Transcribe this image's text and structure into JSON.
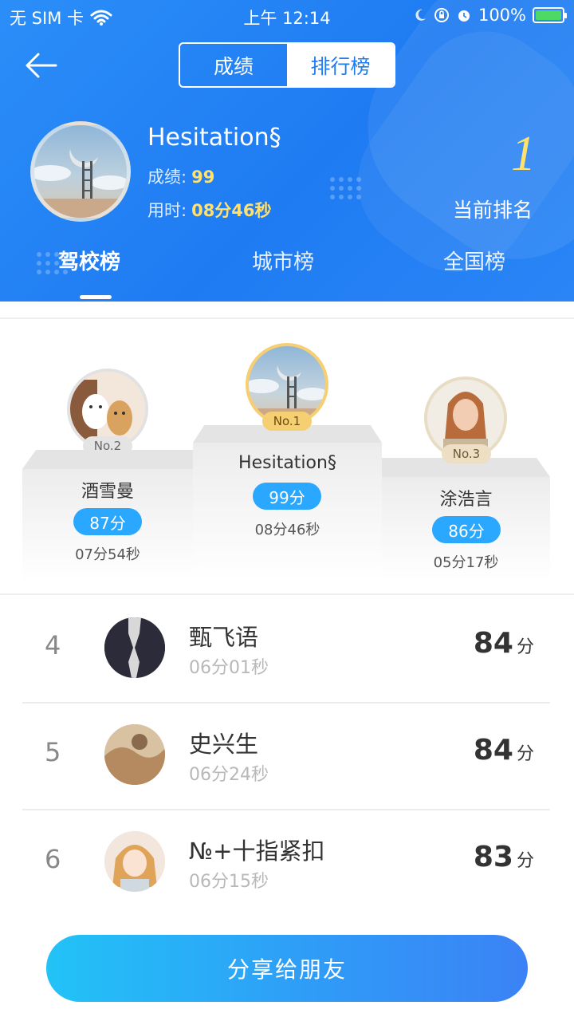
{
  "status_bar": {
    "carrier": "无 SIM 卡",
    "time": "上午 12:14",
    "battery": "100%"
  },
  "nav": {
    "segments": [
      "成绩",
      "排行榜"
    ],
    "active_segment": "排行榜"
  },
  "profile": {
    "name": "Hesitation§",
    "score_label": "成绩:",
    "score_value": "99",
    "time_label": "用时:",
    "time_value": "08分46秒",
    "rank_value": "1",
    "rank_label": "当前排名"
  },
  "tabs": [
    "驾校榜",
    "城市榜",
    "全国榜"
  ],
  "podium": {
    "first": {
      "badge": "No.1",
      "name": "Hesitation§",
      "score": "99分",
      "time": "08分46秒"
    },
    "second": {
      "badge": "No.2",
      "name": "酒雪曼",
      "score": "87分",
      "time": "07分54秒"
    },
    "third": {
      "badge": "No.3",
      "name": "涂浩言",
      "score": "86分",
      "time": "05分17秒"
    }
  },
  "list": [
    {
      "rank": "4",
      "name": "甄飞语",
      "time": "06分01秒",
      "score": "84",
      "unit": "分"
    },
    {
      "rank": "5",
      "name": "史兴生",
      "time": "06分24秒",
      "score": "84",
      "unit": "分"
    },
    {
      "rank": "6",
      "name": "№+十指紧扣",
      "time": "06分15秒",
      "score": "83",
      "unit": "分"
    }
  ],
  "share_button": "分享给朋友",
  "colors": {
    "header_blue": "#1f7bf2",
    "highlight_yellow": "#ffe16b",
    "score_pill": "#2aa8ff"
  }
}
